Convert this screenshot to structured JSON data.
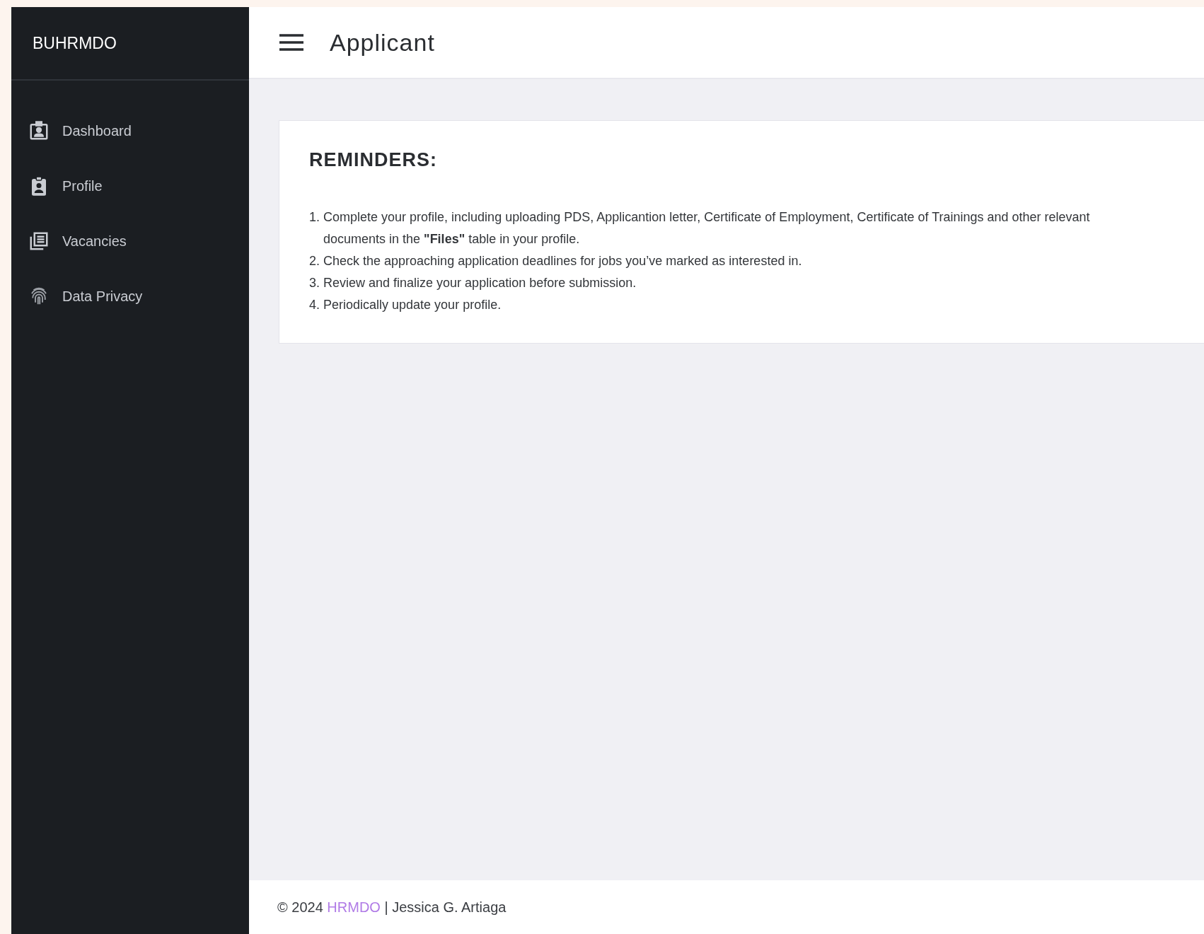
{
  "sidebar": {
    "brand": "BUHRMDO",
    "items": [
      {
        "label": "Dashboard",
        "selected": false
      },
      {
        "label": "Profile",
        "selected": false
      },
      {
        "label": "Vacancies",
        "selected": false
      },
      {
        "label": "Data Privacy",
        "selected": false
      }
    ]
  },
  "header": {
    "title": "Applicant"
  },
  "reminders": {
    "title": "REMINDERS:",
    "items": [
      "1. Complete your profile, including uploading PDS, Applicantion letter, Certificate of Employment, Certificate of Trainings and other relevant documents in the **\"Files\"** table in your profile.",
      "2. Check the approaching application deadlines for jobs you’ve marked as interested in.",
      "3. Review and finalize your application before submission.",
      "4. Periodically update your profile."
    ]
  },
  "footer": {
    "prefix": "© 2024",
    "link": "HRMDO",
    "suffix": "| Jessica G. Artiaga"
  }
}
